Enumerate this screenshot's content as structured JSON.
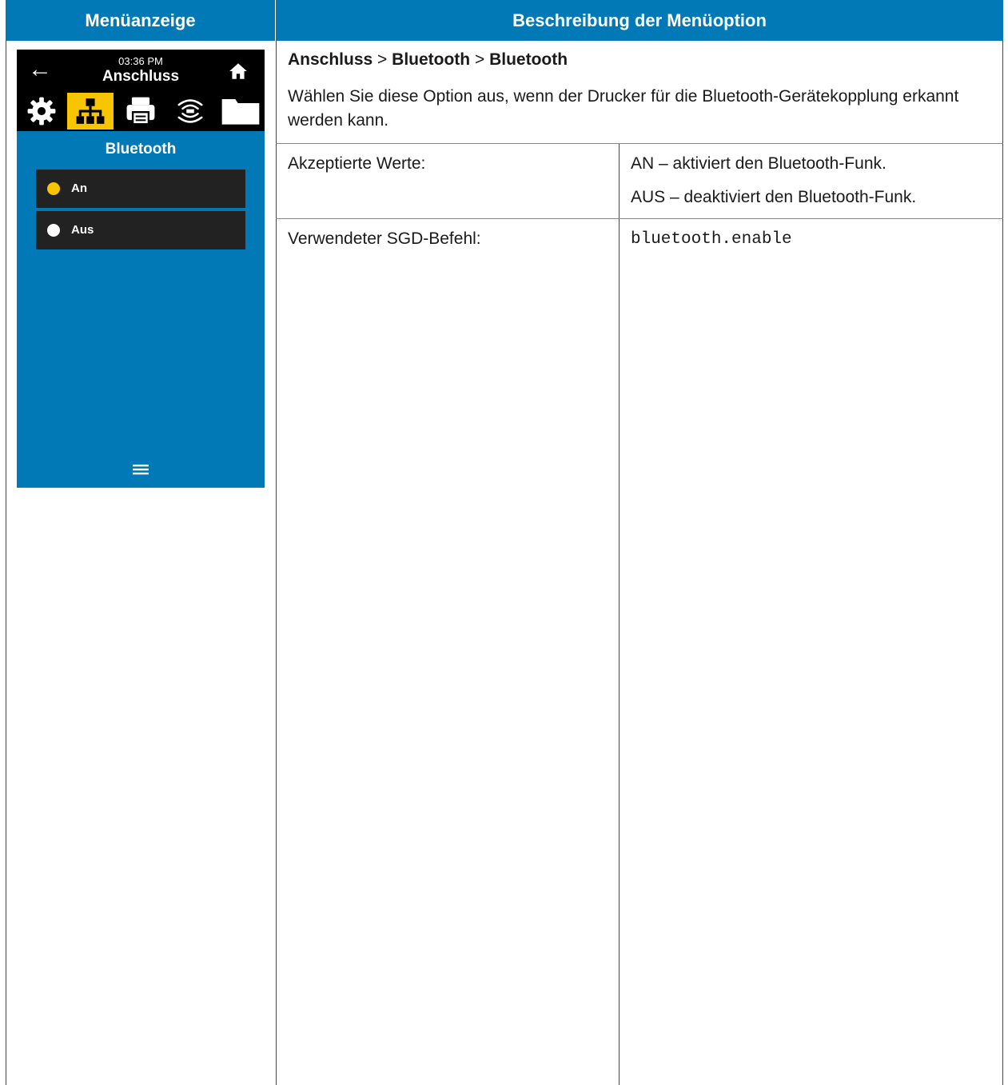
{
  "header": {
    "left": "Menüanzeige",
    "right": "Beschreibung der Menüoption"
  },
  "screen": {
    "time": "03:36 PM",
    "title": "Anschluss",
    "menu_title": "Bluetooth",
    "options": [
      {
        "label": "An",
        "selected": true
      },
      {
        "label": "Aus",
        "selected": false
      }
    ],
    "active_tab": "network-icon",
    "colors": {
      "accent": "#f6c500",
      "background": "#0079b6",
      "bar": "#000000"
    }
  },
  "description": {
    "path": [
      "Anschluss",
      "Bluetooth",
      "Bluetooth"
    ],
    "separator": ">",
    "text": "Wählen Sie diese Option aus, wenn der Drucker für die Bluetooth-Gerätekopplung erkannt werden kann.",
    "accepted_label": "Akzeptierte Werte:",
    "accepted_values": [
      "AN – aktiviert den Bluetooth-Funk.",
      "AUS – deaktiviert den Bluetooth-Funk."
    ],
    "sgd_label": "Verwendeter SGD-Befehl:",
    "sgd_command": "bluetooth.enable"
  }
}
